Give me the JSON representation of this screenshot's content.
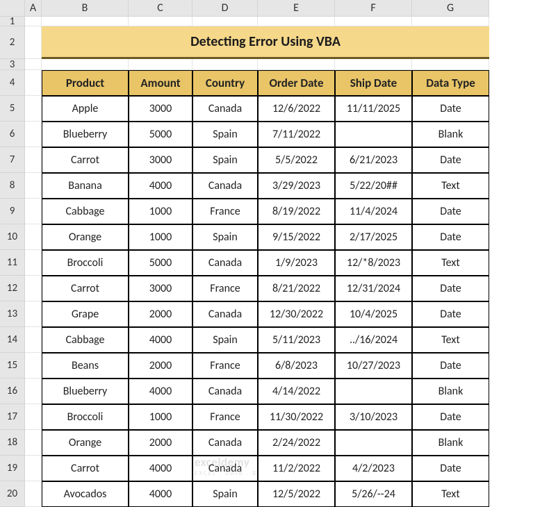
{
  "columns": [
    "A",
    "B",
    "C",
    "D",
    "E",
    "F",
    "G"
  ],
  "rows": [
    "1",
    "2",
    "3",
    "4",
    "5",
    "6",
    "7",
    "8",
    "9",
    "10",
    "11",
    "12",
    "13",
    "14",
    "15",
    "16",
    "17",
    "18",
    "19",
    "20"
  ],
  "title": "Detecting Error Using VBA",
  "headers": [
    "Product",
    "Amount",
    "Country",
    "Order Date",
    "Ship Date",
    "Data Type"
  ],
  "data": [
    {
      "product": "Apple",
      "amount": "3000",
      "country": "Canada",
      "order": "12/6/2022",
      "ship": "11/11/2025",
      "type": "Date"
    },
    {
      "product": "Blueberry",
      "amount": "5000",
      "country": "Spain",
      "order": "7/11/2022",
      "ship": "",
      "type": "Blank"
    },
    {
      "product": "Carrot",
      "amount": "3000",
      "country": "Spain",
      "order": "5/5/2022",
      "ship": "6/21/2023",
      "type": "Date"
    },
    {
      "product": "Banana",
      "amount": "4000",
      "country": "Canada",
      "order": "3/29/2023",
      "ship": "5/22/20##",
      "type": "Text"
    },
    {
      "product": "Cabbage",
      "amount": "1000",
      "country": "France",
      "order": "8/19/2022",
      "ship": "11/4/2024",
      "type": "Date"
    },
    {
      "product": "Orange",
      "amount": "1000",
      "country": "Spain",
      "order": "9/15/2022",
      "ship": "2/17/2025",
      "type": "Date"
    },
    {
      "product": "Broccoli",
      "amount": "5000",
      "country": "Canada",
      "order": "1/9/2023",
      "ship": "12/*8/2023",
      "type": "Text"
    },
    {
      "product": "Carrot",
      "amount": "3000",
      "country": "France",
      "order": "8/21/2022",
      "ship": "12/31/2024",
      "type": "Date"
    },
    {
      "product": "Grape",
      "amount": "2000",
      "country": "Canada",
      "order": "12/30/2022",
      "ship": "10/4/2025",
      "type": "Date"
    },
    {
      "product": "Cabbage",
      "amount": "4000",
      "country": "Spain",
      "order": "5/11/2023",
      "ship": "../16/2024",
      "type": "Text"
    },
    {
      "product": "Beans",
      "amount": "2000",
      "country": "France",
      "order": "6/8/2023",
      "ship": "10/27/2023",
      "type": "Date"
    },
    {
      "product": "Blueberry",
      "amount": "4000",
      "country": "Canada",
      "order": "4/14/2022",
      "ship": "",
      "type": "Blank"
    },
    {
      "product": "Broccoli",
      "amount": "1000",
      "country": "France",
      "order": "11/30/2022",
      "ship": "3/10/2023",
      "type": "Date"
    },
    {
      "product": "Orange",
      "amount": "2000",
      "country": "Canada",
      "order": "2/24/2022",
      "ship": "",
      "type": "Blank"
    },
    {
      "product": "Carrot",
      "amount": "4000",
      "country": "Canada",
      "order": "11/2/2022",
      "ship": "4/2/2023",
      "type": "Date"
    },
    {
      "product": "Avocados",
      "amount": "4000",
      "country": "Spain",
      "order": "12/5/2022",
      "ship": "5/26/--24",
      "type": "Text"
    }
  ],
  "watermark": {
    "main": "exceldemy",
    "sub": "EXCEL . DATA . BI"
  },
  "chart_data": {
    "type": "table",
    "title": "Detecting Error Using VBA",
    "columns": [
      "Product",
      "Amount",
      "Country",
      "Order Date",
      "Ship Date",
      "Data Type"
    ],
    "rows": [
      [
        "Apple",
        3000,
        "Canada",
        "12/6/2022",
        "11/11/2025",
        "Date"
      ],
      [
        "Blueberry",
        5000,
        "Spain",
        "7/11/2022",
        "",
        "Blank"
      ],
      [
        "Carrot",
        3000,
        "Spain",
        "5/5/2022",
        "6/21/2023",
        "Date"
      ],
      [
        "Banana",
        4000,
        "Canada",
        "3/29/2023",
        "5/22/20##",
        "Text"
      ],
      [
        "Cabbage",
        1000,
        "France",
        "8/19/2022",
        "11/4/2024",
        "Date"
      ],
      [
        "Orange",
        1000,
        "Spain",
        "9/15/2022",
        "2/17/2025",
        "Date"
      ],
      [
        "Broccoli",
        5000,
        "Canada",
        "1/9/2023",
        "12/*8/2023",
        "Text"
      ],
      [
        "Carrot",
        3000,
        "France",
        "8/21/2022",
        "12/31/2024",
        "Date"
      ],
      [
        "Grape",
        2000,
        "Canada",
        "12/30/2022",
        "10/4/2025",
        "Date"
      ],
      [
        "Cabbage",
        4000,
        "Spain",
        "5/11/2023",
        "../16/2024",
        "Text"
      ],
      [
        "Beans",
        2000,
        "France",
        "6/8/2023",
        "10/27/2023",
        "Date"
      ],
      [
        "Blueberry",
        4000,
        "Canada",
        "4/14/2022",
        "",
        "Blank"
      ],
      [
        "Broccoli",
        1000,
        "France",
        "11/30/2022",
        "3/10/2023",
        "Date"
      ],
      [
        "Orange",
        2000,
        "Canada",
        "2/24/2022",
        "",
        "Blank"
      ],
      [
        "Carrot",
        4000,
        "Canada",
        "11/2/2022",
        "4/2/2023",
        "Date"
      ],
      [
        "Avocados",
        4000,
        "Spain",
        "12/5/2022",
        "5/26/--24",
        "Text"
      ]
    ]
  }
}
